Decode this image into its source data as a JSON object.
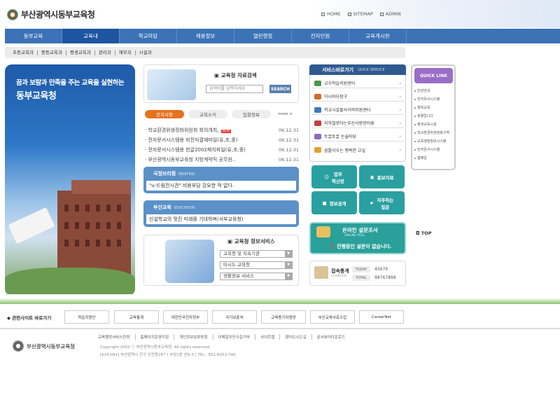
{
  "header": {
    "logo_text": "부산광역시동부교육청",
    "links": [
      "HOME",
      "SITEMAP",
      "ADMIN"
    ]
  },
  "gnb": {
    "items": [
      "동부교육",
      "교육내",
      "학교마당",
      "채용정보",
      "열린행정",
      "전자민원",
      "교육게시판"
    ],
    "active_index": 1
  },
  "subnav": {
    "items": [
      "초등교육과",
      "중등교육과",
      "평생교육과",
      "관리과",
      "재무과",
      "시설과"
    ]
  },
  "hero": {
    "line1": "꿈과 보람과 만족을 주는 교육을 실현하는",
    "line2": "동부교육청"
  },
  "search": {
    "title": "교육청 자료검색",
    "placeholder": "검색어를 입력하세요",
    "button": "SEARCH"
  },
  "news": {
    "tabs": [
      "공지사항",
      "교육소식",
      "입찰정보"
    ],
    "more": "more",
    "items": [
      {
        "title": "학교환경위생정화위원회 회의개최,",
        "date": "06.12.31",
        "new": "NEW"
      },
      {
        "title": "전자문서시스템용 비전자결재파일(유,초,중)",
        "date": "06.12.31"
      },
      {
        "title": "전자문서시스템용 한글2002패치파일(유,초,중)",
        "date": "06.12.31"
      },
      {
        "title": "부산광역시동부교육청 지방계약직 공무원..",
        "date": "06.12.31"
      }
    ]
  },
  "briefing": {
    "title": "국정브리핑",
    "subtitle": "BRIEFING",
    "text": "\"u-드림전시관\" 비용부담 강요한 적 없다."
  },
  "education": {
    "title": "부산교육",
    "subtitle": "EDUCATION",
    "text": "신설학교의 멋진 미래를 기대하며(서부교육청)"
  },
  "info_service": {
    "title": "교육청 정보서비스",
    "selects": [
      "교육청 및 직속기관",
      "타시도 교육청",
      "생활정보 서비스"
    ]
  },
  "quick_service": {
    "title": "서비스바로가기",
    "title_en": "QUICK SERVICE",
    "items": [
      "교수학습지원센터",
      "아나바다장구",
      "학교시설물사이버지원센터",
      "지하철로타는부산사랑방미류",
      "토끌토끌 논술마당",
      "꿈틀이우는 행복한 교실"
    ],
    "colors": [
      "#4a9a4a",
      "#d06a2a",
      "#3a7ab8",
      "#c04040",
      "#8a6ac0",
      "#e0a030"
    ]
  },
  "tiles": [
    {
      "label": "업무\n혁신방"
    },
    {
      "label": "홍보자료"
    },
    {
      "label": "정보공개"
    },
    {
      "label": "자주하는\n질문"
    }
  ],
  "poll": {
    "title": "온라인 설문조사",
    "title_en": "ONLINE POLL",
    "text": "진행중인 설문이 없습니다."
  },
  "counter": {
    "title": "접속통계",
    "title_en": "COUNTER",
    "today_label": "TODAY",
    "today": "45679",
    "total_label": "TOTAL",
    "total": "98767898"
  },
  "quick_link": {
    "title": "QUICK LINK",
    "items": [
      "민원안내",
      "전자독서시스템",
      "행복교육",
      "청렴립니다",
      "평생교육시설",
      "학교환경위생정화구역",
      "교육행정정보시스템",
      "전자문서시스템",
      "웹메일"
    ]
  },
  "top_link": "TOP",
  "related": {
    "title": "관련사이트 바로가기",
    "sites": [
      "학습지원단",
      "교육통계",
      "대한민국전자정부",
      "국가보훈처",
      "교육용기자원망",
      "부산교육사료수집",
      "CareerNet"
    ]
  },
  "footer": {
    "logo_text": "부산광역시동부교육청",
    "links": [
      "교육행정서비스헌장",
      "홈페이지운영지침",
      "개인정보보호방침",
      "이메일무단수집거부",
      "사이트맵",
      "찾아오시는길",
      "문서뷰어다운로드"
    ],
    "copyright": "Copyright 2003 ⓒ 부산광역시동부교육청. All rights reserved.",
    "address": "[614-091] 부산광역시 진구 신천동267 ( 부암1동 산6-3 ) TEL : 051-6053-700"
  },
  "colors": {
    "gnb": "#3b73b6",
    "gnb_active": "#1d55a0",
    "tab_active": "#e8711f",
    "panel": "#5b91c8",
    "tile": "#2aa0a0",
    "quick_link": "#9a6ec8"
  }
}
